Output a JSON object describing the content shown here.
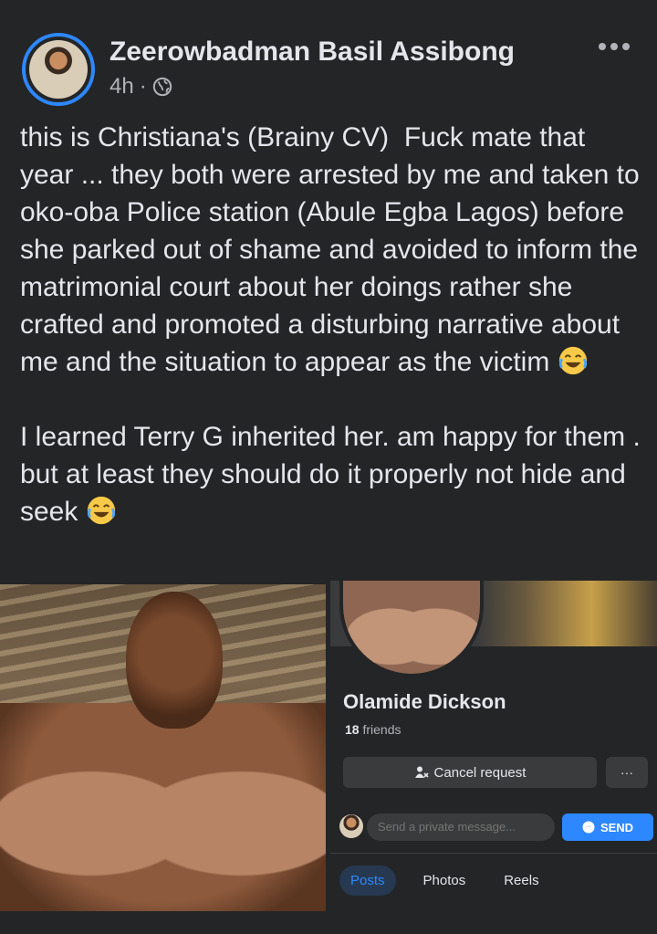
{
  "post": {
    "author": "Zeerowbadman Basil Assibong",
    "time": "4h",
    "separator": "·",
    "paragraph1": "this is Christiana's (Brainy CV)  Fuck mate that year ... they both were arrested by me and taken to oko-oba Police station (Abule Egba Lagos) before she parked out of shame and avoided to inform the matrimonial court about her doings rather she crafted and promoted a disturbing narrative about me and the situation to appear as the victim",
    "paragraph2": "I learned Terry G inherited her. am happy for them . but at least they should do it properly not hide and seek"
  },
  "profile_card": {
    "name": "Olamide Dickson",
    "friends_count": "18",
    "friends_label": "friends",
    "cancel_label": "Cancel request",
    "more_label": "···",
    "message_placeholder": "Send a private message...",
    "send_label": "SEND",
    "tabs": [
      "Posts",
      "Photos",
      "Reels"
    ]
  },
  "icons": {
    "globe": "globe-icon",
    "emoji": "face-with-tears-of-joy-emoji",
    "more": "more-horizontal-icon",
    "messenger": "messenger-icon",
    "cancel_friend": "user-cancel-icon"
  },
  "colors": {
    "background": "#242526",
    "accent": "#2d88ff"
  }
}
